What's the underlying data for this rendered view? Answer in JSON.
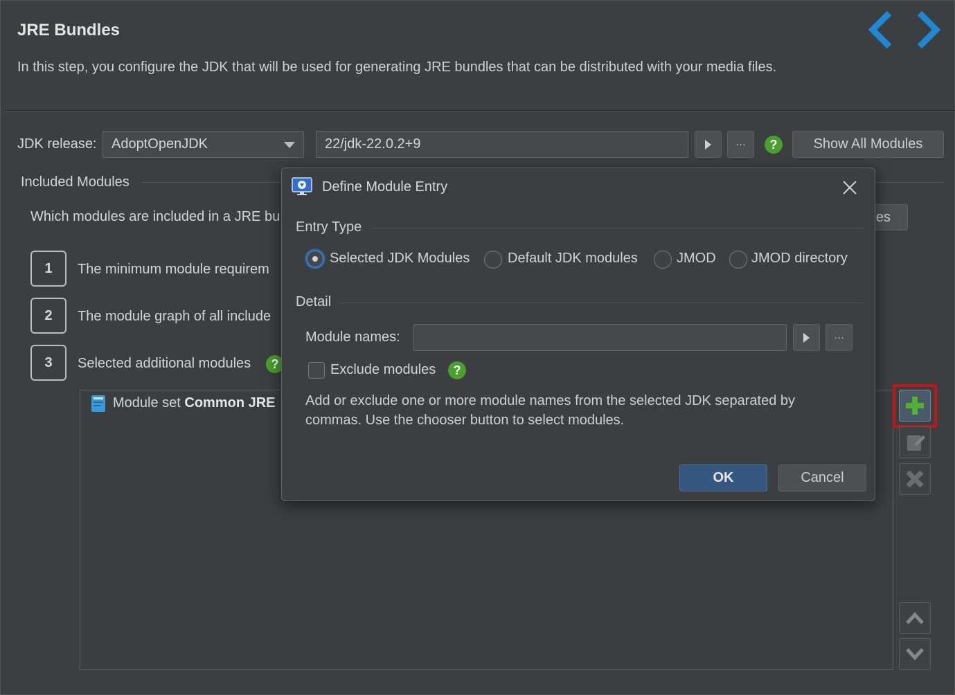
{
  "header": {
    "title": "JRE Bundles",
    "description": "In this step, you configure the JDK that will be used for generating JRE bundles that can be distributed with your media files.",
    "colors": {
      "nav_arrows": "#1e88d3"
    }
  },
  "jdk": {
    "release_label": "JDK release:",
    "release_value": "AdoptOpenJDK",
    "version_value": "22/jdk-22.0.2+9",
    "more_button": "···",
    "show_all_button": "Show All Modules"
  },
  "included": {
    "section_label": "Included Modules",
    "question": "Which modules are included in a JRE bu",
    "partial_button": "les",
    "steps": [
      {
        "num": "1",
        "text": "The minimum module requirem"
      },
      {
        "num": "2",
        "text": "The module graph of all include"
      },
      {
        "num": "3",
        "text": "Selected additional modules"
      }
    ],
    "list_item_prefix": "Module set ",
    "list_item_bold": "Common JRE"
  },
  "dialog": {
    "title": "Define Module Entry",
    "entry_type_label": "Entry Type",
    "radios": [
      "Selected JDK Modules",
      "Default JDK modules",
      "JMOD",
      "JMOD directory"
    ],
    "selected_radio": "Selected JDK Modules",
    "detail_label": "Detail",
    "module_names_label": "Module names:",
    "module_names_value": "",
    "more_button": "···",
    "exclude_label": "Exclude modules",
    "exclude_checked": false,
    "help_line1": "Add or exclude one or more module names from the selected JDK separated by",
    "help_line2": "commas. Use the chooser button to select modules.",
    "ok": "OK",
    "cancel": "Cancel"
  },
  "icons": {
    "prev": "chevron-left-icon",
    "next": "chevron-right-icon",
    "help": "question-icon",
    "add": "plus-icon",
    "edit": "edit-icon",
    "delete": "delete-icon",
    "up": "move-up-icon",
    "down": "move-down-icon",
    "close": "close-icon",
    "app": "installer-app-icon",
    "module": "module-set-icon"
  },
  "help_glyph": "?"
}
